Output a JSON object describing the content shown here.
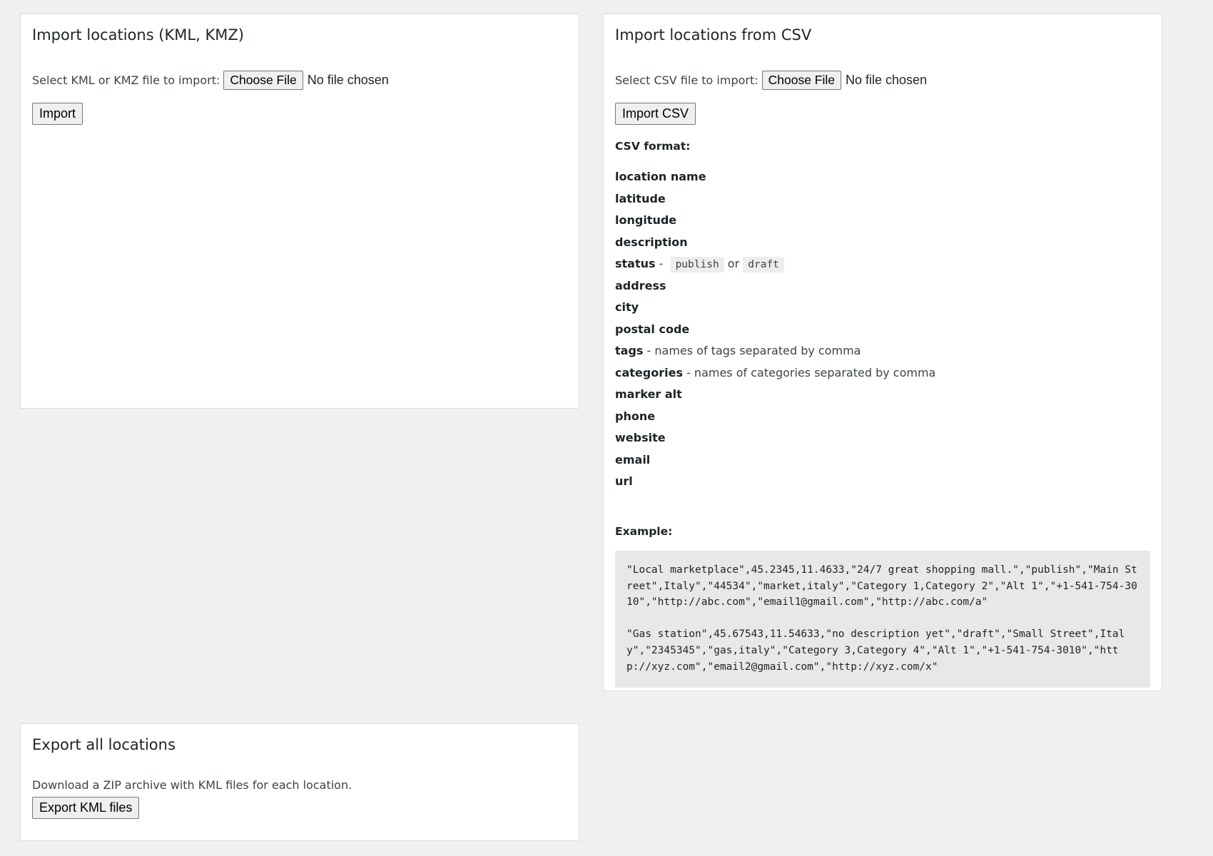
{
  "kml_import": {
    "title": "Import locations (KML, KMZ)",
    "select_label": "Select KML or KMZ file to import:",
    "choose_file_label": "Choose File",
    "file_status": "No file chosen",
    "import_button": "Import"
  },
  "csv_import": {
    "title": "Import locations from CSV",
    "select_label": "Select CSV file to import:",
    "choose_file_label": "Choose File",
    "file_status": "No file chosen",
    "import_button": "Import CSV",
    "format_heading": "CSV format:",
    "fields": [
      {
        "name": "location name",
        "desc": ""
      },
      {
        "name": "latitude",
        "desc": ""
      },
      {
        "name": "longitude",
        "desc": ""
      },
      {
        "name": "description",
        "desc": ""
      },
      {
        "name": "status",
        "sep": " - ",
        "code1": "publish",
        "or": "or",
        "code2": "draft"
      },
      {
        "name": "address",
        "desc": ""
      },
      {
        "name": "city",
        "desc": ""
      },
      {
        "name": "postal code",
        "desc": ""
      },
      {
        "name": "tags",
        "desc": " - names of tags separated by comma"
      },
      {
        "name": "categories",
        "desc": " - names of categories separated by comma"
      },
      {
        "name": "marker alt",
        "desc": ""
      },
      {
        "name": "phone",
        "desc": ""
      },
      {
        "name": "website",
        "desc": ""
      },
      {
        "name": "email",
        "desc": ""
      },
      {
        "name": "url",
        "desc": ""
      }
    ],
    "example_heading": "Example:",
    "example_lines": [
      "\"Local marketplace\",45.2345,11.4633,\"24/7 great shopping mall.\",\"publish\",\"Main Street\",Italy\",\"44534\",\"market,italy\",\"Category 1,Category 2\",\"Alt 1\",\"+1-541-754-3010\",\"http://abc.com\",\"email1@gmail.com\",\"http://abc.com/a\"",
      "\"Gas station\",45.67543,11.54633,\"no description yet\",\"draft\",\"Small Street\",Italy\",\"2345345\",\"gas,italy\",\"Category 3,Category 4\",\"Alt 1\",\"+1-541-754-3010\",\"http://xyz.com\",\"email2@gmail.com\",\"http://xyz.com/x\""
    ]
  },
  "export": {
    "title": "Export all locations",
    "description": "Download a ZIP archive with KML files for each location.",
    "button": "Export KML files"
  }
}
